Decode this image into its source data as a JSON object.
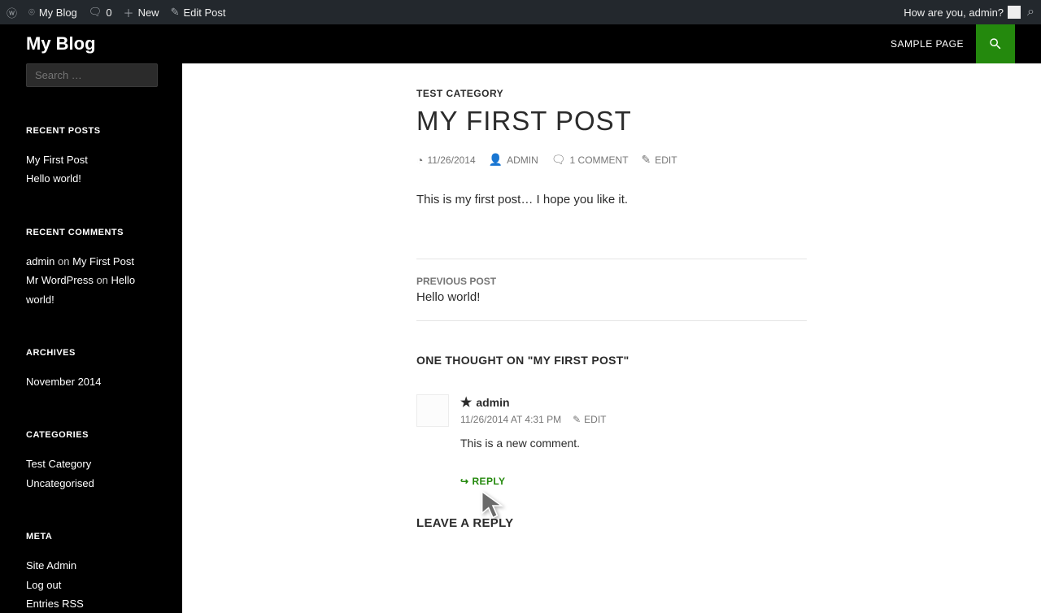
{
  "adminbar": {
    "site_name": "My Blog",
    "comments_count": "0",
    "new_label": "New",
    "edit_label": "Edit Post",
    "greeting": "How are you, admin?"
  },
  "header": {
    "title": "My Blog",
    "nav": {
      "sample_page": "SAMPLE PAGE"
    }
  },
  "sidebar": {
    "search_placeholder": "Search …",
    "recent_posts": {
      "heading": "RECENT POSTS",
      "items": [
        "My First Post",
        "Hello world!"
      ]
    },
    "recent_comments": {
      "heading": "RECENT COMMENTS",
      "items": [
        {
          "author": "admin",
          "on": " on ",
          "post": "My First Post"
        },
        {
          "author": "Mr WordPress",
          "on": " on ",
          "post": "Hello world!"
        }
      ]
    },
    "archives": {
      "heading": "ARCHIVES",
      "items": [
        "November 2014"
      ]
    },
    "categories": {
      "heading": "CATEGORIES",
      "items": [
        "Test Category",
        "Uncategorised"
      ]
    },
    "meta": {
      "heading": "META",
      "items": [
        "Site Admin",
        "Log out",
        "Entries RSS"
      ]
    }
  },
  "post": {
    "category": "TEST CATEGORY",
    "title": "MY FIRST POST",
    "meta": {
      "date": "11/26/2014",
      "author": "ADMIN",
      "comments": "1 COMMENT",
      "edit": "EDIT"
    },
    "content": "This is my first post… I hope you like it."
  },
  "postnav": {
    "prev_label": "PREVIOUS POST",
    "prev_title": "Hello world!"
  },
  "comments": {
    "title": "ONE THOUGHT ON \"MY FIRST POST\"",
    "list": [
      {
        "author": "admin",
        "date": "11/26/2014 AT 4:31 PM",
        "edit": "EDIT",
        "text": "This is a new comment.",
        "reply": "REPLY"
      }
    ]
  },
  "reply_form": {
    "title": "LEAVE A REPLY"
  }
}
